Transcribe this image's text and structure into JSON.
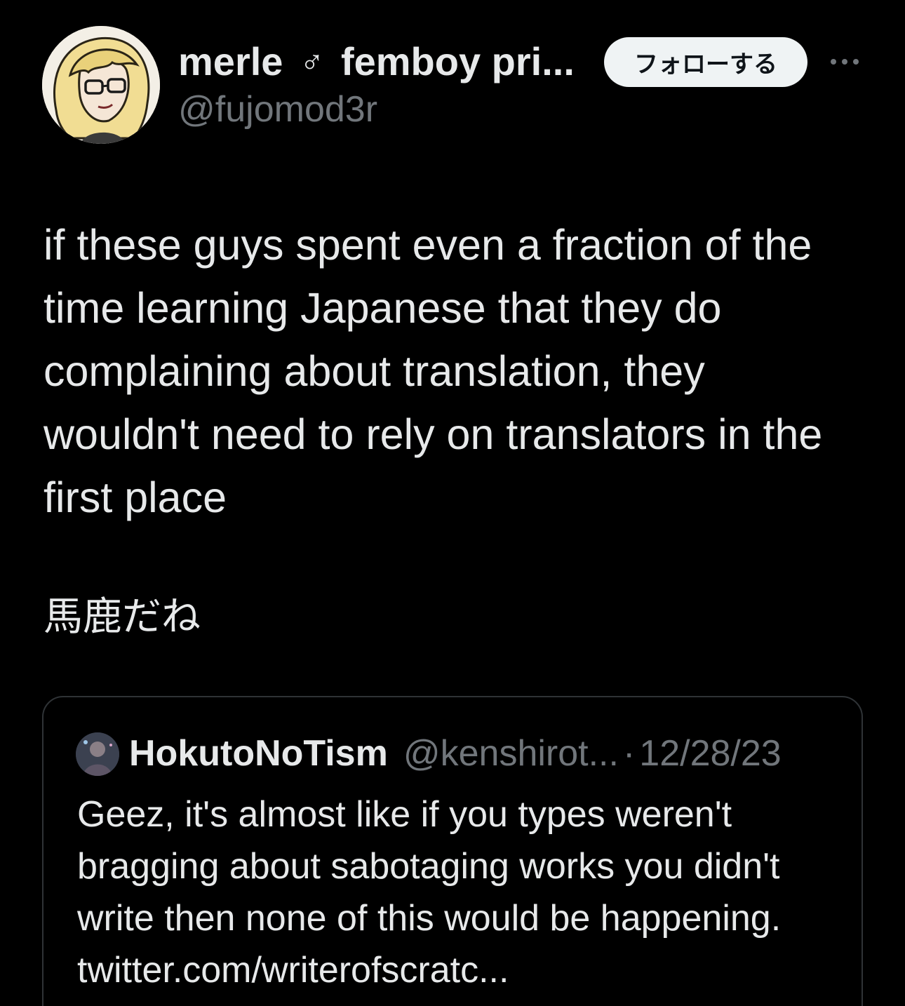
{
  "author": {
    "display_name": "merle",
    "gender_symbol": "♂",
    "display_name_suffix": "femboy pri...",
    "handle": "@fujomod3r"
  },
  "actions": {
    "follow_label": "フォローする",
    "more_icon": "ellipsis-icon"
  },
  "tweet": {
    "text": "if these guys spent even a fraction of the time learning Japanese that they do complaining about translation, they wouldn't need to rely on translators in the first place",
    "japanese_line": "馬鹿だね"
  },
  "quote": {
    "display_name": "HokutoNoTism",
    "handle": "@kenshirot...",
    "separator": "·",
    "date": "12/28/23",
    "text": "Geez, it's almost like if you types weren't bragging about sabotaging works you didn't write then none of this would be happening. twitter.com/writerofscratc..."
  },
  "colors": {
    "background": "#000000",
    "text_primary": "#e7e9ea",
    "text_secondary": "#71767b",
    "border": "#2f3336",
    "follow_bg": "#eff3f4"
  }
}
